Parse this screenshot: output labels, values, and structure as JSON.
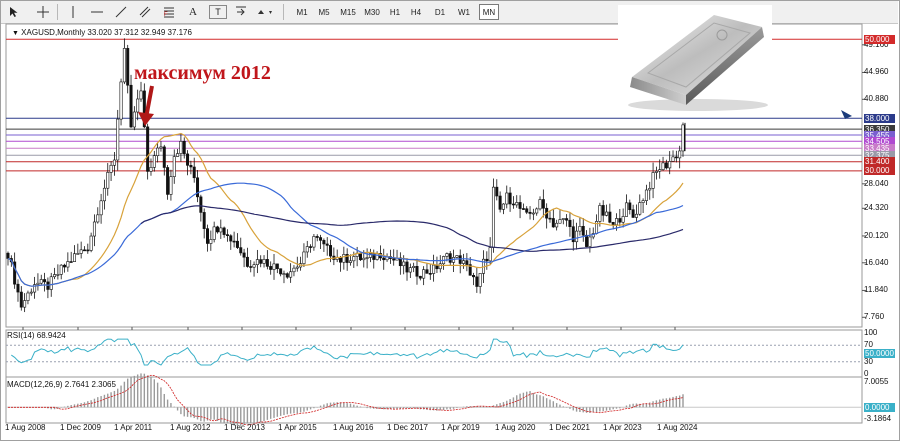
{
  "toolbar": {
    "timeframes": [
      "M1",
      "M5",
      "M15",
      "M30",
      "H1",
      "H4",
      "D1",
      "W1",
      "MN"
    ],
    "active_timeframe": "MN"
  },
  "chart": {
    "info_line": "XAGUSD,Monthly  33.020 37.312 32.949 37.176",
    "caption": "максимум 2012",
    "price_axis": [
      "49.160",
      "44.960",
      "40.880",
      "28.040",
      "24.320",
      "20.120",
      "16.040",
      "11.840",
      "7.760"
    ],
    "h_levels": [
      {
        "label": "50.000",
        "color": "#d32a2a"
      },
      {
        "label": "38.000",
        "color": "#2b3a8a"
      },
      {
        "label": "36.350",
        "color": "#3a3a3a"
      },
      {
        "label": "35.455",
        "color": "#7a5fd0"
      },
      {
        "label": "34.505",
        "color": "#b04ad0"
      },
      {
        "label": "33.435",
        "color": "#c87ac8"
      },
      {
        "label": "32.375",
        "color": "#9a9aa8"
      },
      {
        "label": "31.400",
        "color": "#c02828"
      },
      {
        "label": "30.000",
        "color": "#c02828"
      }
    ],
    "date_axis": [
      "1 Aug 2008",
      "1 Dec 2009",
      "1 Apr 2011",
      "1 Aug 2012",
      "1 Dec 2013",
      "1 Apr 2015",
      "1 Aug 2016",
      "1 Dec 2017",
      "1 Apr 2019",
      "1 Aug 2020",
      "1 Dec 2021",
      "1 Apr 2023",
      "1 Aug 2024"
    ]
  },
  "rsi": {
    "label": "RSI(14) 68.9424",
    "axis": [
      "100",
      "70",
      "30",
      "0"
    ],
    "current": "50.0000"
  },
  "macd": {
    "label": "MACD(12,26,9) 2.7641 2.3065",
    "axis": [
      "7.0055",
      "-3.1864"
    ],
    "current": "0.0000"
  },
  "colors": {
    "bull_bear_candle": "#111111",
    "ma_fast": "#d8a23a",
    "ma_mid": "#3a6ad8",
    "ma_slow": "#2a2a6a",
    "rsi_line": "#3ab0c8",
    "macd_hist": "#9a9a9a",
    "macd_signal": "#d02020"
  }
}
